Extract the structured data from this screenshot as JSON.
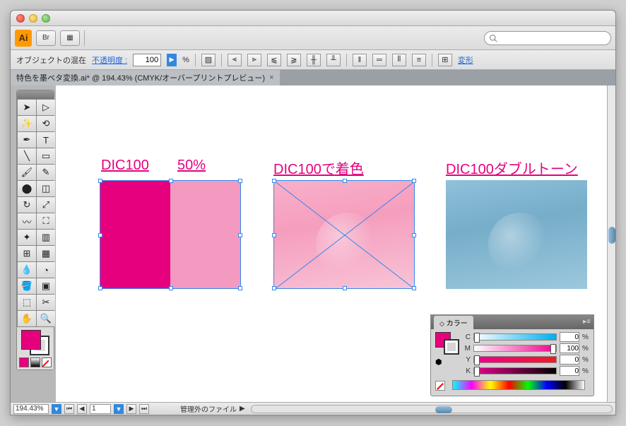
{
  "titlebar_buttons": [
    "Br",
    "grid"
  ],
  "options_bar": {
    "label": "オブジェクトの混在",
    "opacity_label": "不透明度 :",
    "opacity_value": "100",
    "opacity_unit": "%",
    "transform_link": "変形"
  },
  "doc_tab": {
    "title": "特色を墨ベタ変換.ai* @ 194.43% (CMYK/オーバープリントプレビュー)"
  },
  "canvas": {
    "label1a": "DIC100",
    "label1b": "50%",
    "label2": "DIC100で着色",
    "label3": "DIC100ダブルトーン"
  },
  "color_panel": {
    "title": "カラー",
    "channels": [
      {
        "name": "C",
        "value": "0"
      },
      {
        "name": "M",
        "value": "100"
      },
      {
        "name": "Y",
        "value": "0"
      },
      {
        "name": "K",
        "value": "0"
      }
    ],
    "unit": "%"
  },
  "status_bar": {
    "zoom": "194.43%",
    "artboard": "1",
    "doc_info": "管理外のファイル"
  }
}
